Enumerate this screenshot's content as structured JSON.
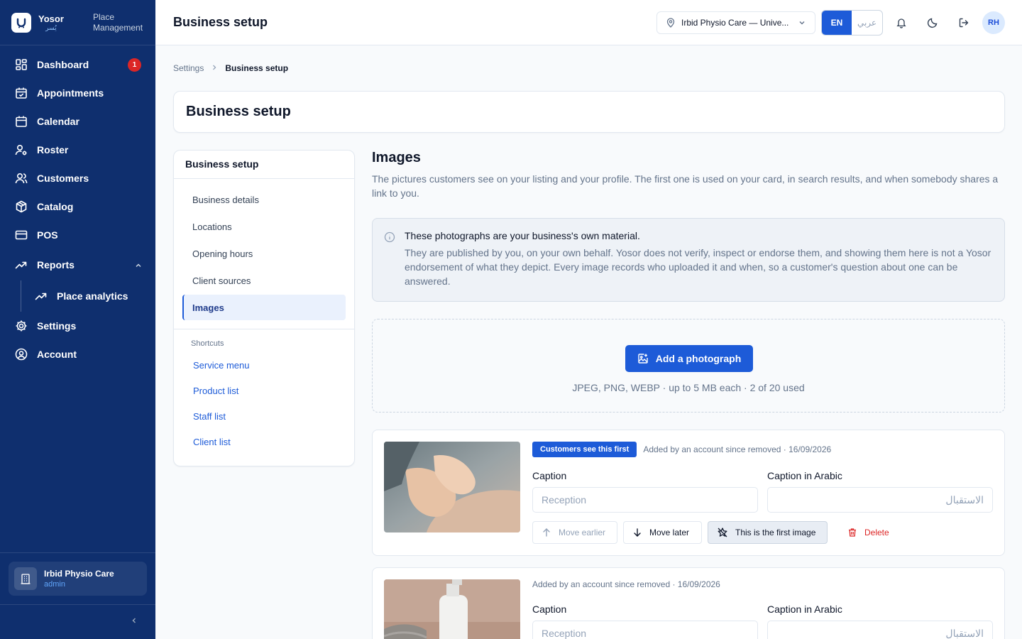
{
  "brand": {
    "name": "Yosor",
    "arabic": "يُسر",
    "subtitle": "Place Management"
  },
  "nav": {
    "dashboard": "Dashboard",
    "dashboard_badge": "1",
    "appointments": "Appointments",
    "calendar": "Calendar",
    "roster": "Roster",
    "customers": "Customers",
    "catalog": "Catalog",
    "pos": "POS",
    "reports": "Reports",
    "place_analytics": "Place analytics",
    "settings": "Settings",
    "account": "Account"
  },
  "place": {
    "name": "Irbid Physio Care",
    "role": "admin"
  },
  "header": {
    "title": "Business setup",
    "location": "Irbid Physio Care — Unive...",
    "lang_en": "EN",
    "lang_ar": "عربي",
    "avatar": "RH"
  },
  "breadcrumb": {
    "parent": "Settings",
    "current": "Business setup"
  },
  "page_title": "Business setup",
  "subnav": {
    "title": "Business setup",
    "items": [
      "Business details",
      "Locations",
      "Opening hours",
      "Client sources",
      "Images"
    ],
    "shortcuts_title": "Shortcuts",
    "shortcuts": [
      "Service menu",
      "Product list",
      "Staff list",
      "Client list"
    ]
  },
  "images": {
    "title": "Images",
    "description": "The pictures customers see on your listing and your profile. The first one is used on your card, in search results, and when somebody shares a link to you.",
    "notice_title": "These photographs are your business's own material.",
    "notice_body": "They are published by you, on your own behalf. Yosor does not verify, inspect or endorse them, and showing them here is not a Yosor endorsement of what they depict. Every image records who uploaded it and when, so a customer's question about one can be answered.",
    "add_button": "Add a photograph",
    "upload_hint": "JPEG, PNG, WEBP · up to 5 MB each · 2 of 20 used"
  },
  "cards": [
    {
      "badge": "Customers see this first",
      "meta": "Added by an account since removed · 16/09/2026",
      "caption_label": "Caption",
      "caption_value": "Reception",
      "caption_ar_label": "Caption in Arabic",
      "caption_ar_value": "الاستقبال",
      "move_earlier": "Move earlier",
      "move_later": "Move later",
      "first_image": "This is the first image",
      "delete": "Delete"
    },
    {
      "meta": "Added by an account since removed · 16/09/2026",
      "caption_label": "Caption",
      "caption_value": "Reception",
      "caption_ar_label": "Caption in Arabic",
      "caption_ar_value": "الاستقبال"
    }
  ],
  "colors": {
    "sidebar": "#0f2f6e",
    "accent": "#1d5bd8",
    "danger": "#dc2626"
  }
}
